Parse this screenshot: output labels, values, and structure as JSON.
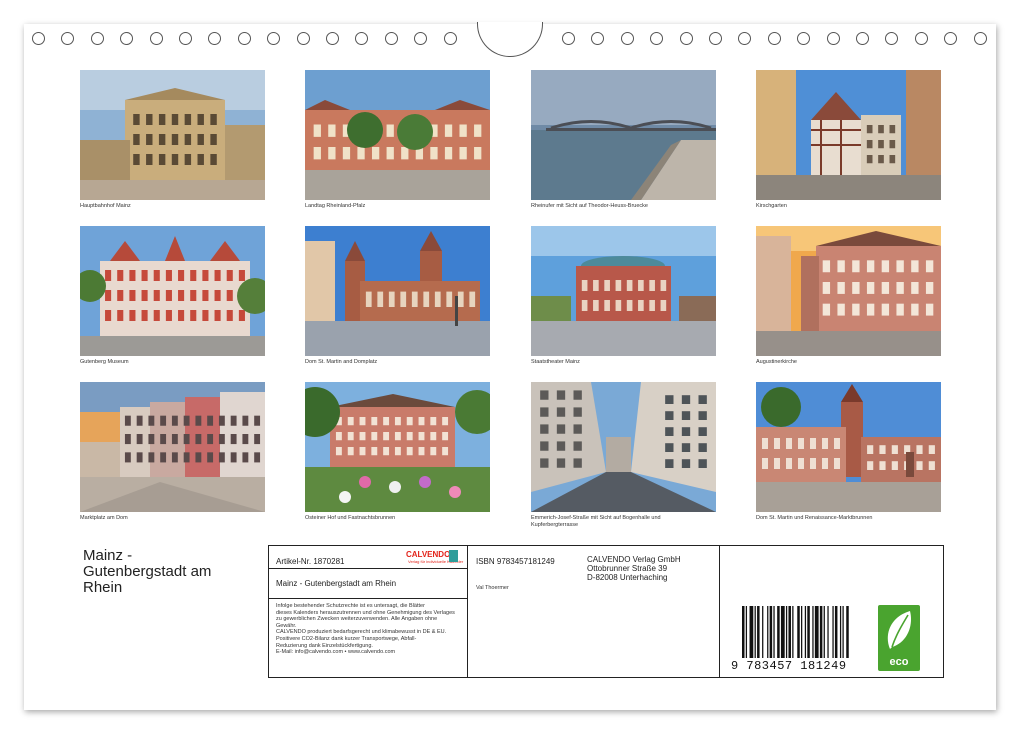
{
  "calendar": {
    "title_lines": [
      "Mainz -",
      "Gutenbergstadt am",
      "Rhein"
    ]
  },
  "photos": [
    {
      "caption": "Hauptbahnhof Mainz",
      "scene": "station"
    },
    {
      "caption": "Landtag Rheinland-Pfalz",
      "scene": "landtag"
    },
    {
      "caption": "Rheinufer mit Sicht auf Theodor-Heuss-Bruecke",
      "scene": "river"
    },
    {
      "caption": "Kirschgarten",
      "scene": "timber"
    },
    {
      "caption": "Gutenberg Museum",
      "scene": "museum"
    },
    {
      "caption": "Dom St. Martin and Domplatz",
      "scene": "dom"
    },
    {
      "caption": "Staatstheater Mainz",
      "scene": "theater"
    },
    {
      "caption": "Augustinerkirche",
      "scene": "augustiner"
    },
    {
      "caption": "Marktplatz am Dom",
      "scene": "markt"
    },
    {
      "caption": "Osteiner Hof und Fastnachtsbrunnen",
      "scene": "osteiner"
    },
    {
      "caption": "Emmerich-Josef-Straße mit Sicht auf Bogenhalle und Kupferbergterrasse",
      "scene": "street"
    },
    {
      "caption": "Dom St. Martin und Renaissance-Marktbrunnen",
      "scene": "dom2"
    }
  ],
  "info": {
    "article": "Artikel-Nr. 1870281",
    "brand": "CALVENDO",
    "brand_sub": "Verlag für individuelle Kalender",
    "isbn": "ISBN 9783457181249",
    "publisher_lines": [
      "CALVENDO Verlag GmbH",
      "Ottobrunner Straße 39",
      "D-82008 Unterhaching"
    ],
    "product_title": "Mainz - Gutenbergstadt am Rhein",
    "author": "Val Thoermer",
    "legal_lines": [
      "Infolge bestehender Schutzrechte ist es untersagt, die Blätter",
      "dieses Kalenders herauszutrennen und ohne Genehmigung des Verlages",
      "zu gewerblichen Zwecken weiterzuverwenden. Alle Angaben ohne",
      "Gewähr.",
      "CALVENDO produziert bedarfsgerecht und klimabewusst in DE & EU.",
      "Positivere CO2-Bilanz dank kurzer Transportwege, Abfall-",
      "Reduzierung dank Einzelstückfertigung.",
      "E-Mail: info@calvendo.com • www.calvendo.com"
    ],
    "barcode_number": "9 783457 181249",
    "eco_label": "eco"
  },
  "colors": {
    "eco_green": "#4aa42f",
    "brand_red": "#e2231a",
    "brand_teal": "#2e9d9a"
  }
}
